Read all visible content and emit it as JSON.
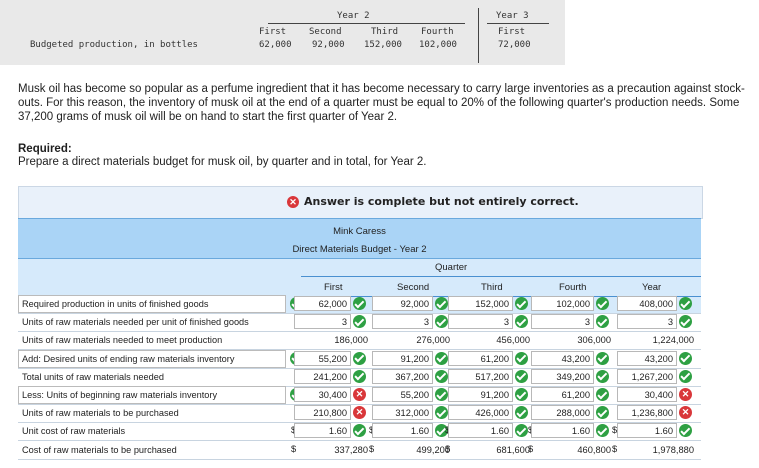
{
  "production_table": {
    "year2_label": "Year 2",
    "year3_label": "Year 3",
    "headers": [
      "First",
      "Second",
      "Third",
      "Fourth"
    ],
    "year3_header": "First",
    "row_label": "Budgeted production, in bottles",
    "values": [
      "62,000",
      "92,000",
      "152,000",
      "102,000"
    ],
    "year3_value": "72,000"
  },
  "problem_text": "Musk oil has become so popular as a perfume ingredient that it has become necessary to carry large inventories as a precaution against stock-outs. For this reason, the inventory of musk oil at the end of a quarter must be equal to 20% of the following quarter's production needs. Some 37,200 grams of musk oil will be on hand to start the first quarter of Year 2.",
  "required_heading": "Required:",
  "required_text": "Prepare a direct materials budget for musk oil, by quarter and in total, for Year 2.",
  "banner_text": "Answer is complete but not entirely correct.",
  "budget": {
    "company": "Mink Caress",
    "title": "Direct Materials Budget - Year 2",
    "quarter_label": "Quarter",
    "columns": [
      "First",
      "Second",
      "Third",
      "Fourth",
      "Year"
    ],
    "rows": [
      {
        "label": "Required production in units of finished goods",
        "values": [
          "62,000",
          "92,000",
          "152,000",
          "102,000",
          "408,000"
        ],
        "status": [
          "ok",
          "ok",
          "ok",
          "ok",
          "ok"
        ],
        "select": true
      },
      {
        "label": "Units of raw materials needed per unit of finished goods",
        "values": [
          "3",
          "3",
          "3",
          "3",
          "3"
        ],
        "status": [
          "ok",
          "ok",
          "ok",
          "ok",
          "ok"
        ],
        "select": false
      },
      {
        "label": "Units of raw materials needed to meet production",
        "values": [
          "186,000",
          "276,000",
          "456,000",
          "306,000",
          "1,224,000"
        ],
        "status": [
          "none",
          "none",
          "none",
          "none",
          "none"
        ],
        "select": false
      },
      {
        "label": "Add: Desired units of ending raw materials inventory",
        "values": [
          "55,200",
          "91,200",
          "61,200",
          "43,200",
          "43,200"
        ],
        "status": [
          "ok",
          "ok",
          "ok",
          "ok",
          "ok"
        ],
        "select": true
      },
      {
        "label": "Total units of raw materials needed",
        "values": [
          "241,200",
          "367,200",
          "517,200",
          "349,200",
          "1,267,200"
        ],
        "status": [
          "ok",
          "ok",
          "ok",
          "ok",
          "ok"
        ],
        "select": false
      },
      {
        "label": "Less: Units of beginning raw materials inventory",
        "values": [
          "30,400",
          "55,200",
          "91,200",
          "61,200",
          "30,400"
        ],
        "status": [
          "err",
          "ok",
          "ok",
          "ok",
          "err"
        ],
        "select": true
      },
      {
        "label": "Units of raw materials to be purchased",
        "values": [
          "210,800",
          "312,000",
          "426,000",
          "288,000",
          "1,236,800"
        ],
        "status": [
          "err",
          "ok",
          "ok",
          "ok",
          "err"
        ],
        "select": false
      },
      {
        "label": "Unit cost of raw materials",
        "values": [
          "1.60",
          "1.60",
          "1.60",
          "1.60",
          "1.60"
        ],
        "status": [
          "ok",
          "ok",
          "ok",
          "ok",
          "ok"
        ],
        "select": false
      },
      {
        "label": "Cost of raw materials to be purchased",
        "values": [
          "337,280",
          "499,200",
          "681,600",
          "460,800",
          "1,978,880"
        ],
        "status": [
          "none",
          "none",
          "none",
          "none",
          "none"
        ],
        "select": false
      }
    ],
    "currency": "$"
  }
}
